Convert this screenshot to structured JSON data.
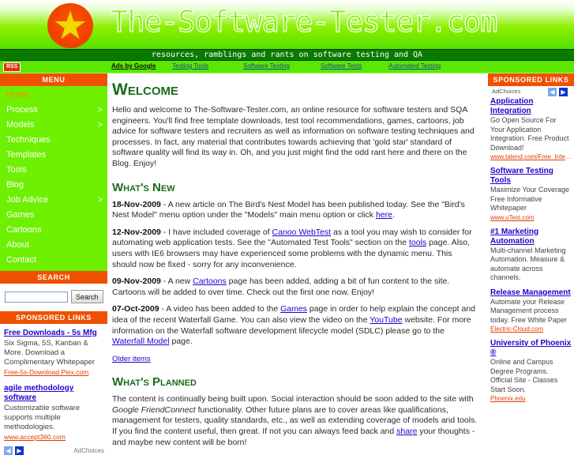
{
  "header": {
    "site_title": "The-Software-Tester.com",
    "tagline": "resources, ramblings and rants on software testing and QA",
    "rss_label": "RSS",
    "ads_by_google": "Ads by Google",
    "nav_links": [
      "Testing Tools",
      "Software Testing",
      "Software Tests",
      "Automated Testing"
    ]
  },
  "sidebar": {
    "menu_heading": "MENU",
    "items": [
      {
        "label": "Home",
        "submenu": false,
        "active": true
      },
      {
        "label": "Process",
        "submenu": true,
        "active": false
      },
      {
        "label": "Models",
        "submenu": true,
        "active": false
      },
      {
        "label": "Techniques",
        "submenu": false,
        "active": false
      },
      {
        "label": "Templates",
        "submenu": false,
        "active": false
      },
      {
        "label": "Tools",
        "submenu": false,
        "active": false
      },
      {
        "label": "Blog",
        "submenu": false,
        "active": false
      },
      {
        "label": "Job Advice",
        "submenu": true,
        "active": false
      },
      {
        "label": "Games",
        "submenu": false,
        "active": false
      },
      {
        "label": "Cartoons",
        "submenu": false,
        "active": false
      },
      {
        "label": "About",
        "submenu": false,
        "active": false
      },
      {
        "label": "Contact",
        "submenu": false,
        "active": false
      }
    ],
    "search_heading": "SEARCH",
    "search_value": "",
    "search_placeholder": "",
    "search_button": "Search",
    "sponsored_heading": "SPONSORED LINKS",
    "ads": [
      {
        "title": "Free Downloads - 5s Mfg",
        "desc": "Six Sigma, 5S, Kanban & More. Download a Complimentary Whitepaper",
        "url": "Free-5s-Download.Plex.com"
      },
      {
        "title": "agile methodology software",
        "desc": "Customizable software supports multiple methodologies.",
        "url": "www.accept360.com"
      }
    ],
    "adchoices": "AdChoices",
    "prev_arrow": "◀",
    "next_arrow": "▶"
  },
  "main": {
    "welcome_heading": "Welcome",
    "welcome_body": "Hello and welcome to The-Software-Tester.com, an online resource for software testers and SQA engineers. You'll find free template downloads, test tool recommendations, games, cartoons, job advice for software testers and recruiters as well as information on software testing techniques and processes. In fact, any material that contributes towards achieving that 'gold star' standard of software quality will find its way in. Oh, and you just might find the odd rant here and there on the Blog. Enjoy!",
    "whats_new_heading": "What's New",
    "news": [
      {
        "date": "18-Nov-2009",
        "text_1": " - A new article on The Bird's Nest Model has been published today. See the \"Bird's Nest Model\" menu option under the \"Models\" main menu option or click ",
        "link_1": "here",
        "text_2": "."
      },
      {
        "date": "12-Nov-2009",
        "text_1": " - I have included coverage of ",
        "link_1": "Canoo WebTest",
        "text_2": " as a tool you may wish to consider for automating web application tests. See the \"Automated Test Tools\" section on the ",
        "link_2": "tools",
        "text_3": " page. Also, users with IE6 browsers may have experienced some problems with the dynamic menu. This should now be fixed - sorry for any inconvenience."
      },
      {
        "date": "09-Nov-2009",
        "text_1": " - A new ",
        "link_1": "Cartoons",
        "text_2": " page has been added, adding a bit of fun content to the site. Cartoons will be added to over time. Check out the first one now. Enjoy!"
      },
      {
        "date": "07-Oct-2009",
        "text_1": " - A video has been added to the ",
        "link_1": "Games",
        "text_2": " page in order to help explain the concept and idea of the recent Waterfall Game. You can also view the video on the ",
        "link_2": "YouTube",
        "text_3": " website. For more information on the Waterfall software development lifecycle model (SDLC) please go to the ",
        "link_3": "Waterfall Model",
        "text_4": " page."
      }
    ],
    "older_items": "Older items",
    "whats_planned_heading": "What's Planned",
    "planned_text_1": "The content is continually being built upon. Social interaction should be soon added to the site with ",
    "planned_em": "Google FriendConnect",
    "planned_text_2": " functionality. Other future plans are to cover areas like qualifications, management for testers, quality standards, etc., as well as extending coverage of models and tools. If you find the content useful, then great. If not you can always feed back and ",
    "planned_link": "share",
    "planned_text_3": " your thoughts - and maybe new content will be born!"
  },
  "right_sidebar": {
    "sponsored_heading": "SPONSORED LINKS",
    "adchoices": "AdChoices",
    "prev_arrow": "◀",
    "next_arrow": "▶",
    "ads": [
      {
        "title": "Application Integration",
        "desc": "Go Open Source For Your Application Integration. Free Product Download!",
        "url": "www.talend.com/Free_Integrat..."
      },
      {
        "title": "Software Testing Tools",
        "desc": "Maximize Your Coverage Free Informative Whitepaper",
        "url": "www.uTest.com"
      },
      {
        "title": "#1 Marketing Automation",
        "desc": "Multi-channel Marketing Automation. Measure & automate across channels.",
        "url": ""
      },
      {
        "title": "Release Management",
        "desc": "Automate your Release Management process today. Free White Paper",
        "url": "Electric-Cloud.com"
      },
      {
        "title": "University of Phoenix ®",
        "desc": "Online and Campus Degree Programs. Official Site - Classes Start Soon.",
        "url": "Phoenix.edu"
      }
    ]
  },
  "colors": {
    "accent_orange": "#f05000",
    "menu_green": "#6ef000",
    "heading_green": "#1d6b1d",
    "link_blue": "#2200cc"
  }
}
